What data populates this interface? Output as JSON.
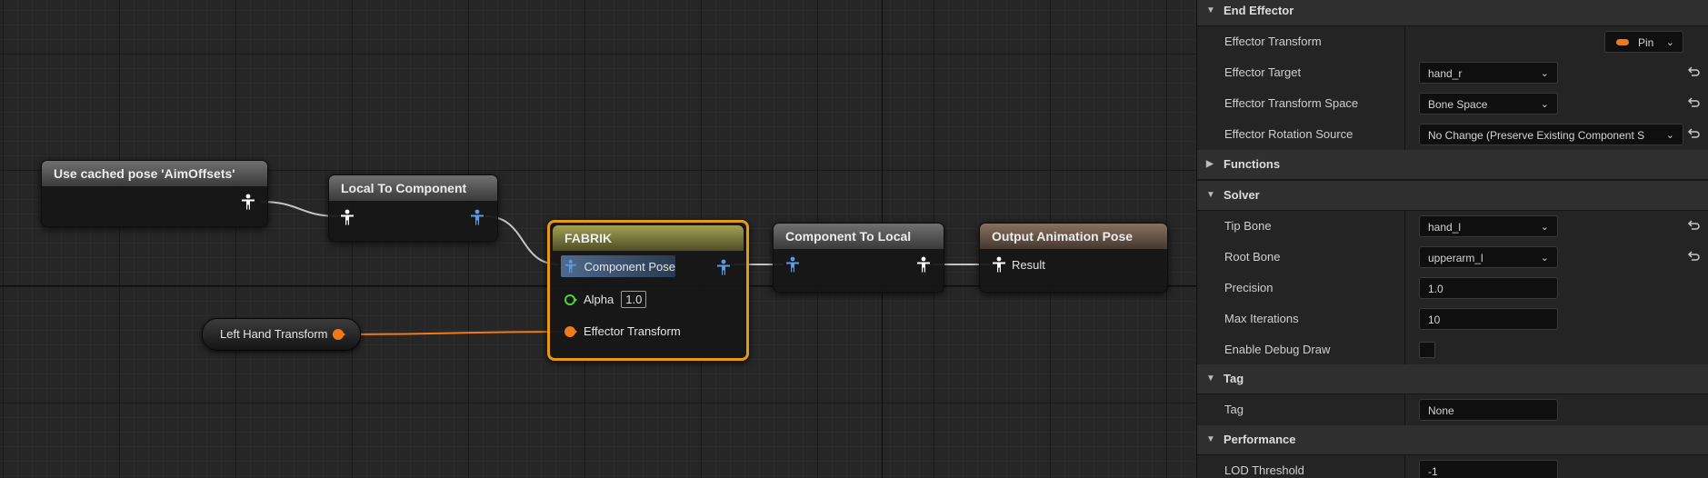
{
  "graph": {
    "nodes": {
      "cached_pose": {
        "title": "Use cached pose 'AimOffsets'"
      },
      "local_to_component": {
        "title": "Local To Component"
      },
      "fabrik": {
        "title": "FABRIK",
        "component_pose_label": "Component Pose",
        "alpha_label": "Alpha",
        "alpha_value": "1.0",
        "effector_transform_label": "Effector Transform"
      },
      "component_to_local": {
        "title": "Component To Local"
      },
      "output_pose": {
        "title": "Output Animation Pose",
        "result_label": "Result"
      },
      "left_hand_transform": {
        "label": "Left Hand Transform"
      }
    },
    "colors": {
      "pose_pin": "#ffffff",
      "pose_pin_blue": "#5e9be6",
      "transform_pin": "#f07a1a",
      "float_pin": "#4fd13c",
      "selection": "#e69a14"
    }
  },
  "details": {
    "sections": {
      "end_effector": "End Effector",
      "functions": "Functions",
      "solver": "Solver",
      "tag": "Tag",
      "performance": "Performance"
    },
    "effector_transform": {
      "label": "Effector Transform",
      "button": "Pin"
    },
    "effector_target": {
      "label": "Effector Target",
      "value": "hand_r"
    },
    "effector_transform_space": {
      "label": "Effector Transform Space",
      "value": "Bone Space"
    },
    "effector_rotation_source": {
      "label": "Effector Rotation Source",
      "value": "No Change (Preserve Existing Component S"
    },
    "tip_bone": {
      "label": "Tip Bone",
      "value": "hand_l"
    },
    "root_bone": {
      "label": "Root Bone",
      "value": "upperarm_l"
    },
    "precision": {
      "label": "Precision",
      "value": "1.0"
    },
    "max_iterations": {
      "label": "Max Iterations",
      "value": "10"
    },
    "enable_debug_draw": {
      "label": "Enable Debug Draw",
      "checked": false
    },
    "tag": {
      "label": "Tag",
      "value": "None"
    },
    "lod_threshold": {
      "label": "LOD Threshold",
      "value": "-1"
    }
  }
}
